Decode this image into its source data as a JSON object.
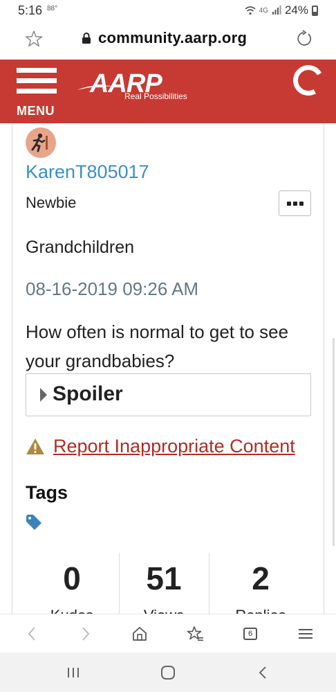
{
  "status_bar": {
    "time": "5:16",
    "temperature": "88°",
    "network": "4G",
    "battery": "24%"
  },
  "url_bar": {
    "url": "community.aarp.org"
  },
  "site_header": {
    "menu_label": "MENU",
    "logo_word": "AARP",
    "logo_tagline": "Real Possibilities",
    "brand_color": "#c73a33"
  },
  "post": {
    "author": "KarenT805017",
    "rank": "Newbie",
    "subject": "Grandchildren",
    "date": "08-16-2019 09:26 AM",
    "body": "How often is normal to get to see your grandbabies?",
    "spoiler_label": "Spoiler",
    "report_link": "Report Inappropriate Content",
    "tags_heading": "Tags"
  },
  "stats": [
    {
      "value": "0",
      "label": "Kudos"
    },
    {
      "value": "51",
      "label": "Views"
    },
    {
      "value": "2",
      "label": "Replies"
    }
  ],
  "browser_toolbar": {
    "tabs_count": "6"
  }
}
